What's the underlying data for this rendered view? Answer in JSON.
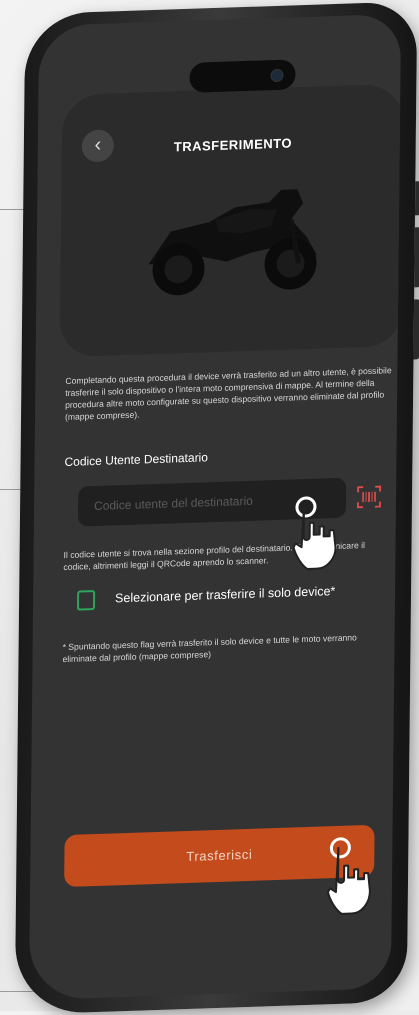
{
  "header": {
    "title": "TRASFERIMENTO",
    "back_icon": "chevron-left-icon"
  },
  "description": "Completando questa procedura il device verrà trasferito ad un altro utente, è possibile trasferire il solo dispositivo o l'intera moto comprensiva di mappe. Al termine della procedura altre moto configurate su questo dispositivo verranno eliminate dal profilo (mappe comprese).",
  "recipient": {
    "label": "Codice Utente Destinatario",
    "value": "",
    "placeholder": "Codice utente del destinatario",
    "scan_icon": "qrcode-scan-icon"
  },
  "hint": "Il codice utente si trova nella sezione profilo del destinatario. Fatti comunicare il codice, altrimenti leggi il QRCode aprendo lo scanner.",
  "device_only": {
    "label": "Selezionare per trasferire il solo device*",
    "checked": false
  },
  "footnote": "* Spuntando questo flag verrà trasferito il solo device e tutte le moto verranno eliminate dal profilo (mappe comprese)",
  "action": {
    "label": "Trasferisci"
  },
  "colors": {
    "screen_bg": "#333333",
    "card_bg": "#2b2b2b",
    "accent": "#c44b1c",
    "checkbox_border": "#2ea55a",
    "qr_icon": "#e14d4d"
  }
}
